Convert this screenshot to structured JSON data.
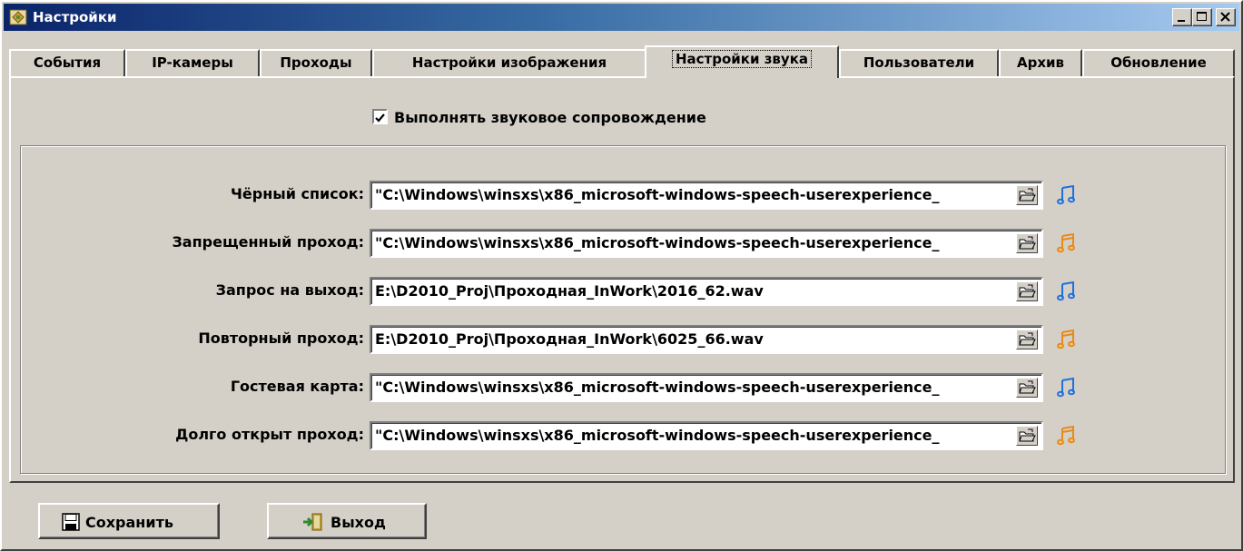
{
  "window": {
    "title": "Настройки"
  },
  "tabs": [
    {
      "label": "События",
      "active": false
    },
    {
      "label": "IP-камеры",
      "active": false
    },
    {
      "label": "Проходы",
      "active": false
    },
    {
      "label": "Настройки изображения",
      "active": false
    },
    {
      "label": "Настройки звука",
      "active": true
    },
    {
      "label": "Пользователи",
      "active": false
    },
    {
      "label": "Архив",
      "active": false
    },
    {
      "label": "Обновление",
      "active": false
    }
  ],
  "sound": {
    "enable_label": "Выполнять звуковое сопровождение",
    "enabled": true,
    "rows": [
      {
        "label": "Чёрный список:",
        "value": "\"C:\\Windows\\winsxs\\x86_microsoft-windows-speech-userexperience_",
        "icon": "music-note-blue-icon"
      },
      {
        "label": "Запрещенный проход:",
        "value": "\"C:\\Windows\\winsxs\\x86_microsoft-windows-speech-userexperience_",
        "icon": "music-note-orange-icon"
      },
      {
        "label": "Запрос на выход:",
        "value": "E:\\D2010_Proj\\Проходная_InWork\\2016_62.wav",
        "icon": "music-note-blue-icon"
      },
      {
        "label": "Повторный проход:",
        "value": "E:\\D2010_Proj\\Проходная_InWork\\6025_66.wav",
        "icon": "music-note-orange-icon"
      },
      {
        "label": "Гостевая карта:",
        "value": "\"C:\\Windows\\winsxs\\x86_microsoft-windows-speech-userexperience_",
        "icon": "music-note-blue-icon"
      },
      {
        "label": "Долго открыт проход:",
        "value": "\"C:\\Windows\\winsxs\\x86_microsoft-windows-speech-userexperience_",
        "icon": "music-note-orange-icon"
      }
    ]
  },
  "buttons": {
    "save_label": "Сохранить",
    "exit_label": "Выход"
  },
  "colors": {
    "note_blue": "#1e6fe0",
    "note_orange": "#e88a1a",
    "title_gradient_start": "#0a246a",
    "title_gradient_end": "#a6caf0"
  }
}
